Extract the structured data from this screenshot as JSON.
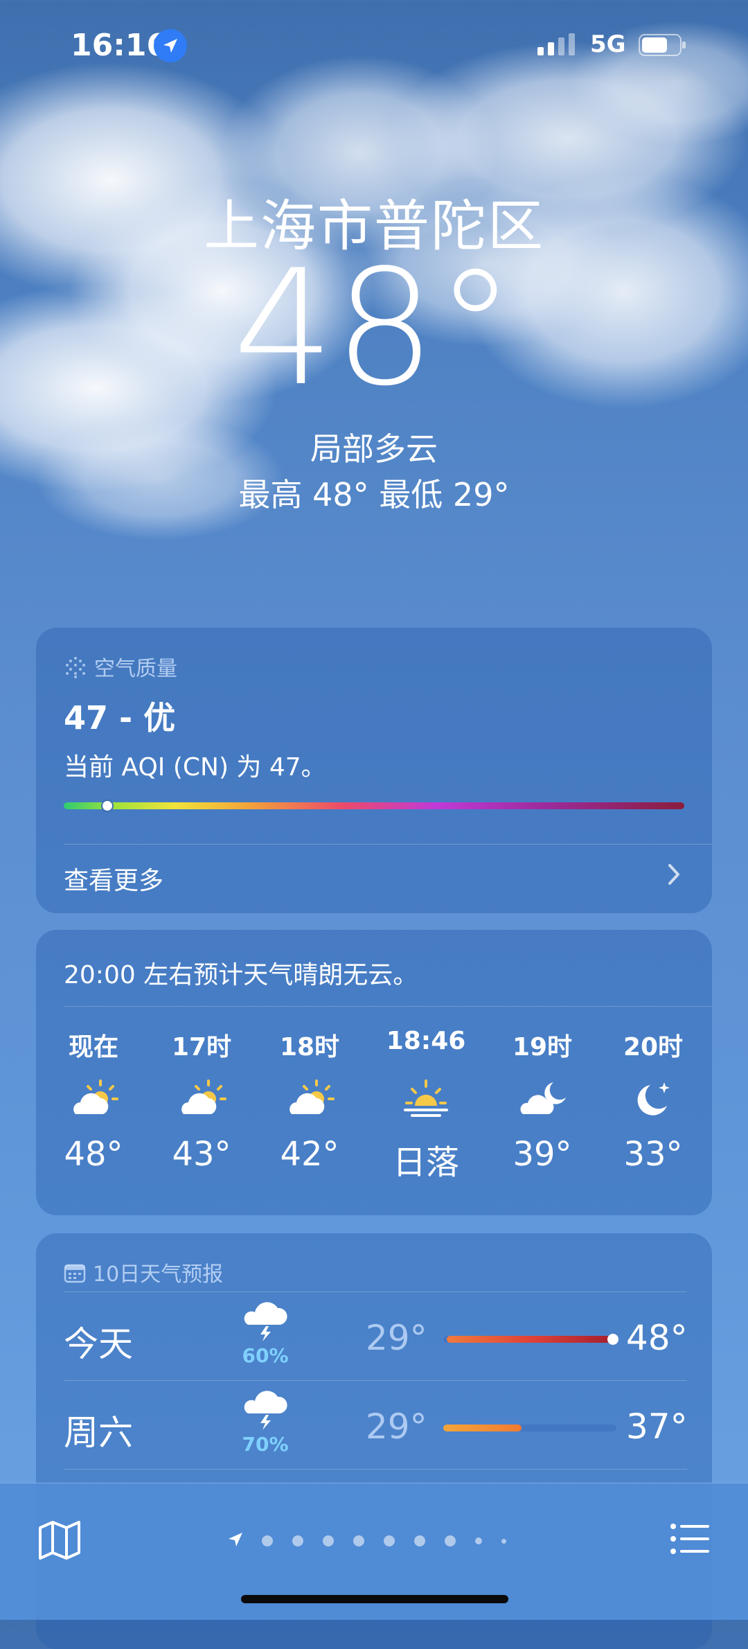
{
  "status_bar": {
    "time": "16:16",
    "network": "5G"
  },
  "location": {
    "city": "上海市普陀区",
    "temperature": "48°",
    "condition": "局部多云",
    "high_low": "最高 48°  最低 29°"
  },
  "air_quality": {
    "header": "空气质量",
    "value": "47 - 优",
    "description": "当前 AQI (CN) 为 47。",
    "see_more": "查看更多",
    "aqi_position": 0.07
  },
  "hourly": {
    "summary": "20:00 左右预计天气晴朗无云。",
    "items": [
      {
        "label": "现在",
        "icon": "partly-sunny-icon",
        "temp": "48°"
      },
      {
        "label": "17时",
        "icon": "partly-sunny-icon",
        "temp": "43°"
      },
      {
        "label": "18时",
        "icon": "partly-sunny-icon",
        "temp": "42°"
      },
      {
        "label": "18:46",
        "icon": "sunset-icon",
        "temp": "日落"
      },
      {
        "label": "19时",
        "icon": "partly-cloudy-night-icon",
        "temp": "39°"
      },
      {
        "label": "20时",
        "icon": "clear-night-icon",
        "temp": "33°"
      }
    ]
  },
  "daily": {
    "header": "10日天气预报",
    "rows": [
      {
        "day": "今天",
        "icon": "thunderstorm-icon",
        "precip": "60%",
        "low": "29°",
        "high": "48°",
        "bar_start": 0.02,
        "bar_end": 1.0,
        "current": 0.98,
        "bar_colors": [
          "#f07b3c",
          "#e04236",
          "#a11e2e"
        ]
      },
      {
        "day": "周六",
        "icon": "thunderstorm-icon",
        "precip": "70%",
        "low": "29°",
        "high": "37°",
        "bar_start": 0.0,
        "bar_end": 0.45,
        "bar_colors": [
          "#f3a63b",
          "#f27a30"
        ]
      }
    ]
  },
  "colors": {
    "accent_blue": "#2f7cf6",
    "precip_blue": "#7fd0ff"
  }
}
